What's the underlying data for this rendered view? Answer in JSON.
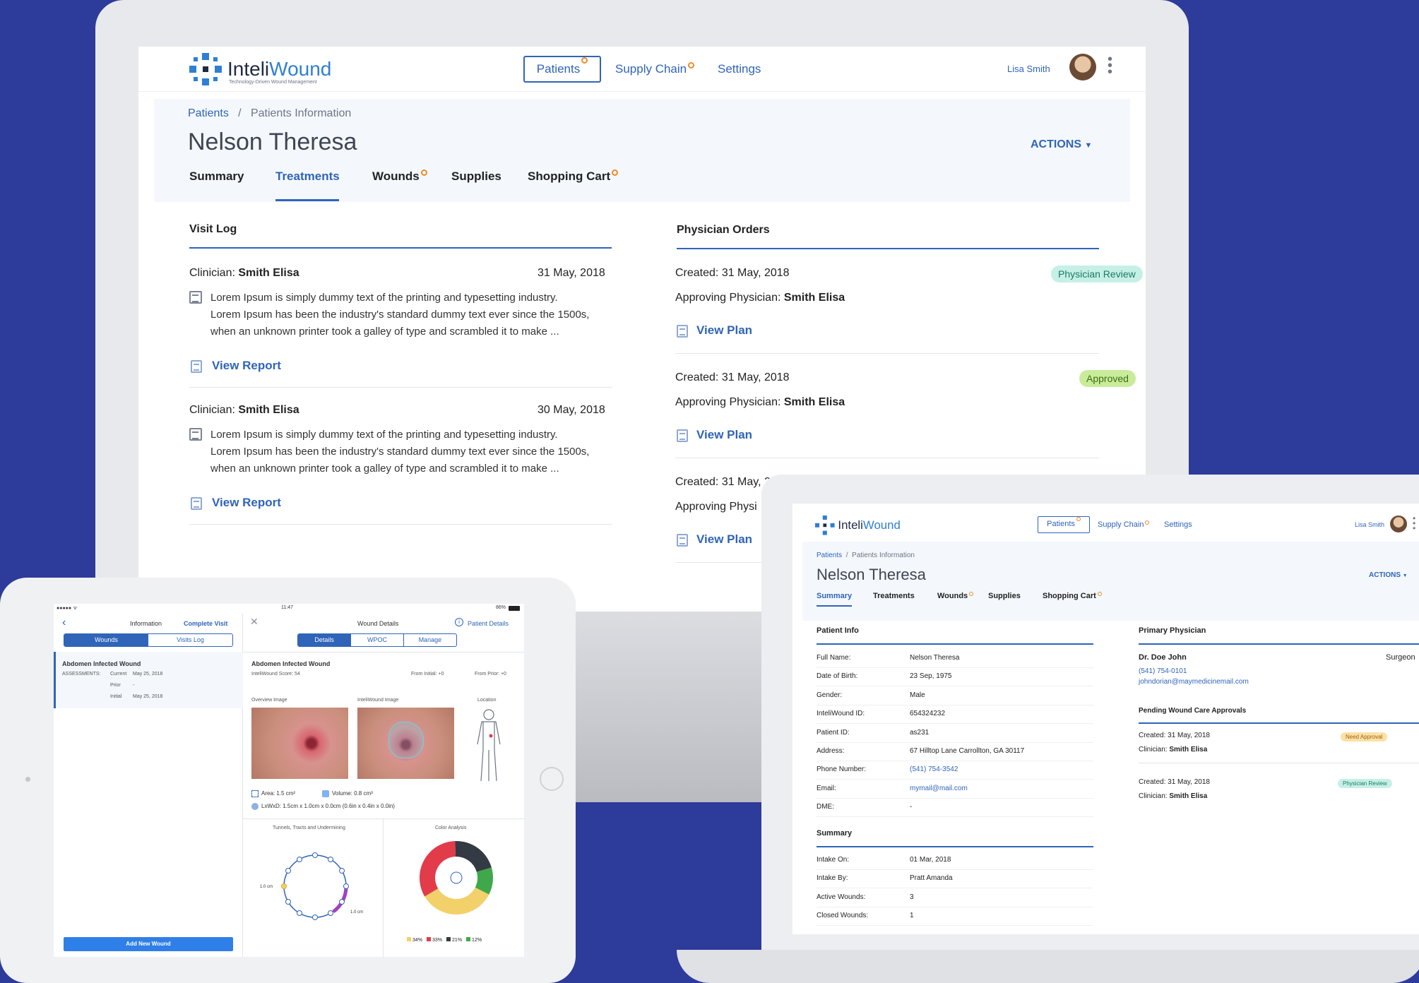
{
  "brand": {
    "name_a": "Inteli",
    "name_b": "Wound",
    "tagline": "Technology-Driven Wound Management"
  },
  "nav": {
    "patients": "Patients",
    "supply_chain": "Supply Chain",
    "settings": "Settings",
    "user": "Lisa Smith"
  },
  "breadcrumb": {
    "root": "Patients",
    "sep": "/",
    "current": "Patients Information"
  },
  "patient_name": "Nelson Theresa",
  "actions_label": "ACTIONS",
  "tabs": {
    "summary": "Summary",
    "treatments": "Treatments",
    "wounds": "Wounds",
    "supplies": "Supplies",
    "cart": "Shopping Cart"
  },
  "visit_log": {
    "title": "Visit Log",
    "clinician_label": "Clinician:",
    "entries": [
      {
        "clinician": "Smith Elisa",
        "date": "31 May, 2018",
        "l1": "Lorem Ipsum is simply dummy text of the printing and typesetting industry.",
        "l2": "Lorem Ipsum has been the industry's standard dummy text ever since the 1500s,",
        "l3": "when an unknown printer took a galley of type and scrambled it to make  ...",
        "link": "View Report"
      },
      {
        "clinician": "Smith Elisa",
        "date": "30 May, 2018",
        "l1": "Lorem Ipsum is simply dummy text of the printing and typesetting industry.",
        "l2": "Lorem Ipsum has been the industry's standard dummy text ever since the 1500s,",
        "l3": "when an unknown printer took a galley of type and scrambled it to make  ...",
        "link": "View Report"
      }
    ]
  },
  "physician_orders": {
    "title": "Physician Orders",
    "approving_label": "Approving Physician:",
    "orders": [
      {
        "created": "Created: 31 May, 2018",
        "physician": "Smith Elisa",
        "status": "Physician Review",
        "link": "View Plan"
      },
      {
        "created": "Created: 31 May, 2018",
        "physician": "Smith Elisa",
        "status": "Approved",
        "link": "View Plan"
      },
      {
        "created": "Created: 31 May, 2",
        "approving_partial": "Approving Physi",
        "link": "View Plan"
      }
    ]
  },
  "colors": {
    "accent": "#2f64b9",
    "badge_dot": "#f08a24",
    "review_bg": "#c6f0e6",
    "approved_bg": "#c8ec9a",
    "need_bg": "#fde0a6",
    "background": "#2d3b9b"
  },
  "tablet": {
    "status_time": "11:47",
    "battery": "86%",
    "left_title": "Information",
    "complete_visit": "Complete Visit",
    "seg_left": [
      "Wounds",
      "Visits Log"
    ],
    "wound_name": "Abdomen Infected Wound",
    "assessments_label": "ASSESSMENTS:",
    "assess_rows": [
      [
        "Current",
        "May 25, 2018"
      ],
      [
        "Prior",
        "-"
      ],
      [
        "Initial",
        "May 25, 2018"
      ]
    ],
    "add_wound": "Add New Wound",
    "details_title": "Wound Details",
    "patient_details": "Patient Details",
    "seg_right": [
      "Details",
      "WPOC",
      "Manage"
    ],
    "score": "InteliWound Score: 54",
    "from_initial": "From Initial: +0",
    "from_prior": "From Prior: +0",
    "overview_label": "Overview Image",
    "inteli_label": "InteliWound Image",
    "location_label": "Location",
    "area": "Area: 1.5 cm²",
    "volume": "Volume: 0.8 cm³",
    "dims": "LxWxD: 1.5cm x 1.0cm x 0.0cm (0.6in x 0.4in x 0.0in)",
    "tunnels_title": "Tunnels, Tracts and Undermining",
    "tun_left": "1.0 cm",
    "tun_right": "1.0 cm",
    "color_title": "Color Analysis",
    "color_legend": [
      {
        "label": "34%",
        "value": 34,
        "color": "#f2d16b"
      },
      {
        "label": "33%",
        "value": 33,
        "color": "#e23b4a"
      },
      {
        "label": "21%",
        "value": 21,
        "color": "#333a44"
      },
      {
        "label": "12%",
        "value": 12,
        "color": "#3fa84a"
      }
    ]
  },
  "laptop": {
    "patient_info_title": "Patient Info",
    "info_rows": [
      {
        "k": "Full Name:",
        "v": "Nelson Theresa"
      },
      {
        "k": "Date of Birth:",
        "v": "23 Sep, 1975"
      },
      {
        "k": "Gender:",
        "v": "Male"
      },
      {
        "k": "InteliWound ID:",
        "v": "654324232"
      },
      {
        "k": "Patient ID:",
        "v": "as231"
      },
      {
        "k": "Address:",
        "v": "67 Hilltop Lane Carrollton, GA 30117"
      },
      {
        "k": "Phone Number:",
        "v": "(541) 754-3542"
      },
      {
        "k": "Email:",
        "v": "mymail@mail.com"
      },
      {
        "k": "DME:",
        "v": "-"
      }
    ],
    "summary_title": "Summary",
    "summary_rows": [
      {
        "k": "Intake On:",
        "v": "01 Mar, 2018"
      },
      {
        "k": "Intake By:",
        "v": "Pratt Amanda"
      },
      {
        "k": "Active Wounds:",
        "v": "3"
      },
      {
        "k": "Closed Wounds:",
        "v": "1"
      }
    ],
    "primary_title": "Primary Physician",
    "doctor": "Dr. Doe John",
    "specialty": "Surgeon",
    "phone": "(541) 754-0101",
    "email": "johndorian@maymedicinemail.com",
    "pending_title": "Pending Wound Care Approvals",
    "pending": [
      {
        "created": "Created: 31 May, 2018",
        "clinician_label": "Clinician:",
        "clinician": "Smith Elisa",
        "status": "Need Approval"
      },
      {
        "created": "Created: 31 May, 2018",
        "clinician_label": "Clinician:",
        "clinician": "Smith Elisa",
        "status": "Physician Review"
      }
    ]
  }
}
